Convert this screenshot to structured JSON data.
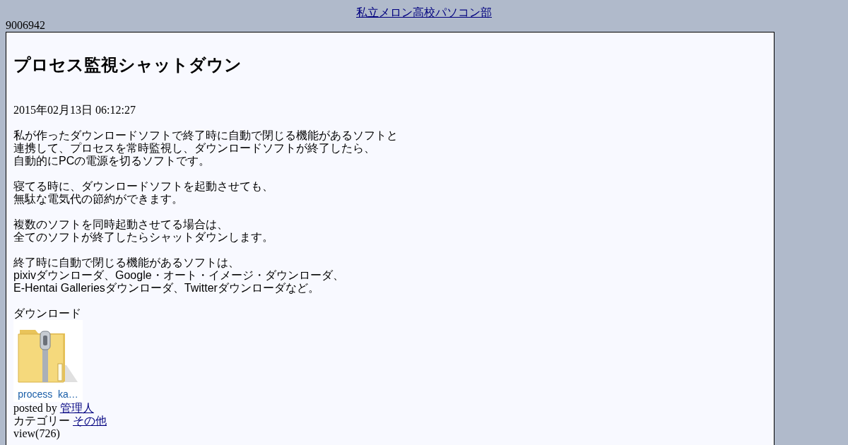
{
  "site_link": "私立メロン高校パソコン部",
  "counter": "9006942",
  "article": {
    "title": "プロセス監視シャットダウン",
    "date": "2015年02月13日 06:12:27",
    "paragraphs": [
      [
        "私が作ったダウンロードソフトで終了時に自動で閉じる機能があるソフトと",
        "連携して、プロセスを常時監視し、ダウンロードソフトが終了したら、",
        "自動的にPCの電源を切るソフトです。"
      ],
      [
        "寝てる時に、ダウンロードソフトを起動させても、",
        "無駄な電気代の節約ができます。"
      ],
      [
        "複数のソフトを同時起動させてる場合は、",
        "全てのソフトが終了したらシャットダウンします。"
      ],
      [
        "終了時に自動で閉じる機能があるソフトは、",
        "pixivダウンローダ、Google・オート・イメージ・ダウンローダ、",
        "E-Hentai Galleriesダウンローダ、Twitterダウンローダなど。"
      ]
    ],
    "download_label": "ダウンロード",
    "file": {
      "name": "process  ka…"
    },
    "posted_by_label": "posted by",
    "author": "管理人",
    "category_label": "カテゴリー",
    "category": "その他",
    "views": "view(726)"
  }
}
